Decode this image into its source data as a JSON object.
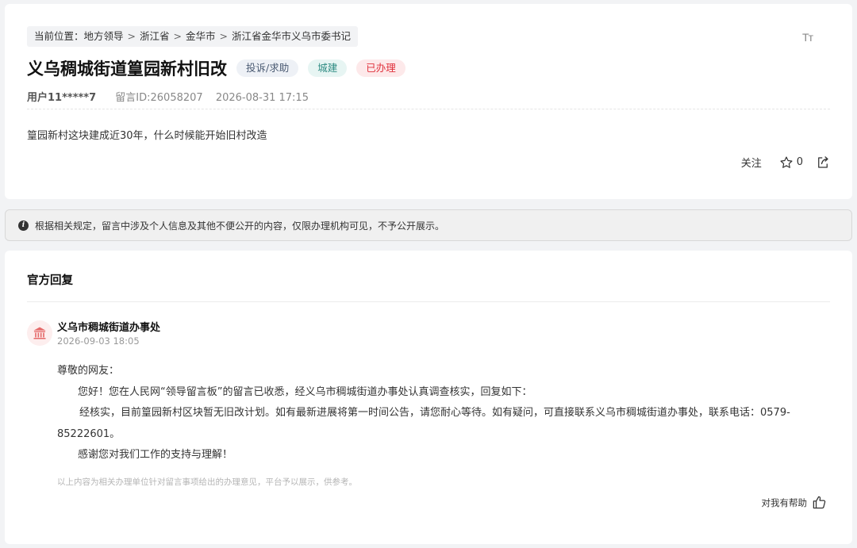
{
  "breadcrumb": {
    "prefix": "当前位置：",
    "items": [
      "地方领导",
      "浙江省",
      "金华市",
      "浙江省金华市义乌市委书记"
    ],
    "separator": ">"
  },
  "font_toggle": "Tт",
  "post": {
    "title": "义乌稠城街道篁园新村旧改",
    "tags": {
      "type": "投诉/求助",
      "category": "城建",
      "status": "已办理"
    },
    "user": "用户11*****7",
    "message_id": "留言ID:26058207",
    "datetime": "2026-08-31 17:15",
    "content": "篁园新村这块建成近30年，什么时候能开始旧村改造"
  },
  "actions": {
    "follow_label": "关注",
    "star_count": "0"
  },
  "notice": "根据相关规定，留言中涉及个人信息及其他不便公开的内容，仅限办理机构可见，不予公开展示。",
  "reply": {
    "heading": "官方回复",
    "org_name": "义乌市稠城街道办事处",
    "org_time": "2026-09-03 18:05",
    "greeting": "尊敬的网友：",
    "para1": "您好！您在人民网“领导留言板”的留言已收悉，经义乌市稠城街道办事处认真调查核实，回复如下：",
    "para2": "经核实，目前篁园新村区块暂无旧改计划。如有最新进展将第一时间公告，请您耐心等待。如有疑问，可直接联系义乌市稠城街道办事处，联系电话：0579-85222601。",
    "para3": "感谢您对我们工作的支持与理解！",
    "disclaimer": "以上内容为相关办理单位针对留言事项给出的办理意见，平台予以展示，供参考。",
    "helpful_label": "对我有帮助"
  },
  "colors": {
    "status_red": "#e0313c",
    "category_teal": "#2f8c83",
    "type_slate": "#4a5a72",
    "org_icon_red": "#e56a6a"
  }
}
